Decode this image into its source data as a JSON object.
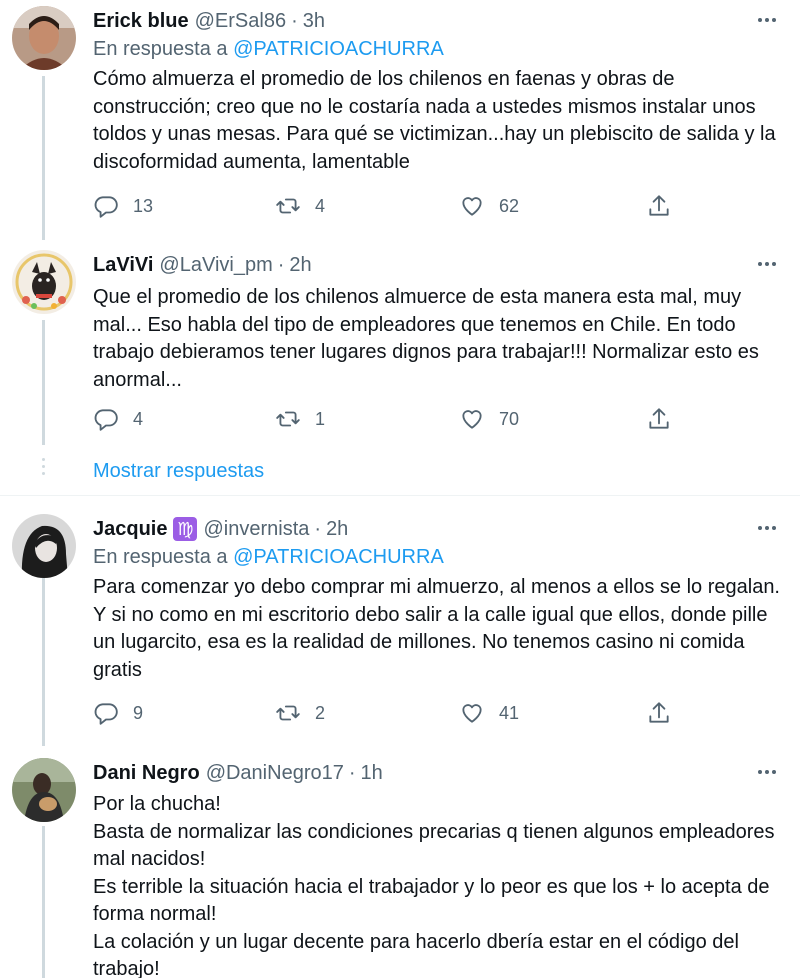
{
  "tweets": [
    {
      "name": "Erick blue",
      "handle": "@ErSal86",
      "time": "3h",
      "reply_prefix": "En respuesta a ",
      "reply_mention": "@PATRICIOACHURRA",
      "text": "Cómo almuerza el promedio de los chilenos en faenas y obras de construcción; creo que no le costaría nada a ustedes mismos instalar unos toldos y unas mesas. Para qué se victimizan...hay un plebiscito de salida y la discoformidad aumenta, lamentable",
      "replies": "13",
      "retweets": "4",
      "likes": "62"
    },
    {
      "name": "LaViVi",
      "handle": "@LaVivi_pm",
      "time": "2h",
      "text": "Que el promedio de los chilenos almuerce de esta manera esta mal, muy mal... Eso habla del tipo de empleadores que tenemos en Chile. En todo trabajo debieramos tener lugares dignos para trabajar!!! Normalizar esto es anormal...",
      "replies": "4",
      "retweets": "1",
      "likes": "70"
    },
    {
      "name": "Jacquie",
      "badge": "♍",
      "handle": "@invernista",
      "time": "2h",
      "reply_prefix": "En respuesta a ",
      "reply_mention": "@PATRICIOACHURRA",
      "text": "Para comenzar yo debo comprar mi almuerzo, al menos a ellos se lo regalan. Y si no como en mi escritorio debo salir a la calle igual que ellos, donde pille un lugarcito, esa es la realidad de millones. No tenemos casino ni comida gratis",
      "replies": "9",
      "retweets": "2",
      "likes": "41"
    },
    {
      "name": "Dani Negro",
      "handle": "@DaniNegro17",
      "time": "1h",
      "text": "Por la chucha!\nBasta de normalizar las condiciones precarias q tienen algunos empleadores mal nacidos!\nEs terrible la situación hacia el trabajador y lo peor es que los + lo acepta de forma normal!\nLa colación y un lugar decente para hacerlo dbería estar en el código del trabajo!"
    }
  ],
  "show_replies": "Mostrar respuestas",
  "colors": {
    "accent": "#1d9bf0",
    "secondary_text": "#536471",
    "thread_line": "#cfd9de"
  }
}
